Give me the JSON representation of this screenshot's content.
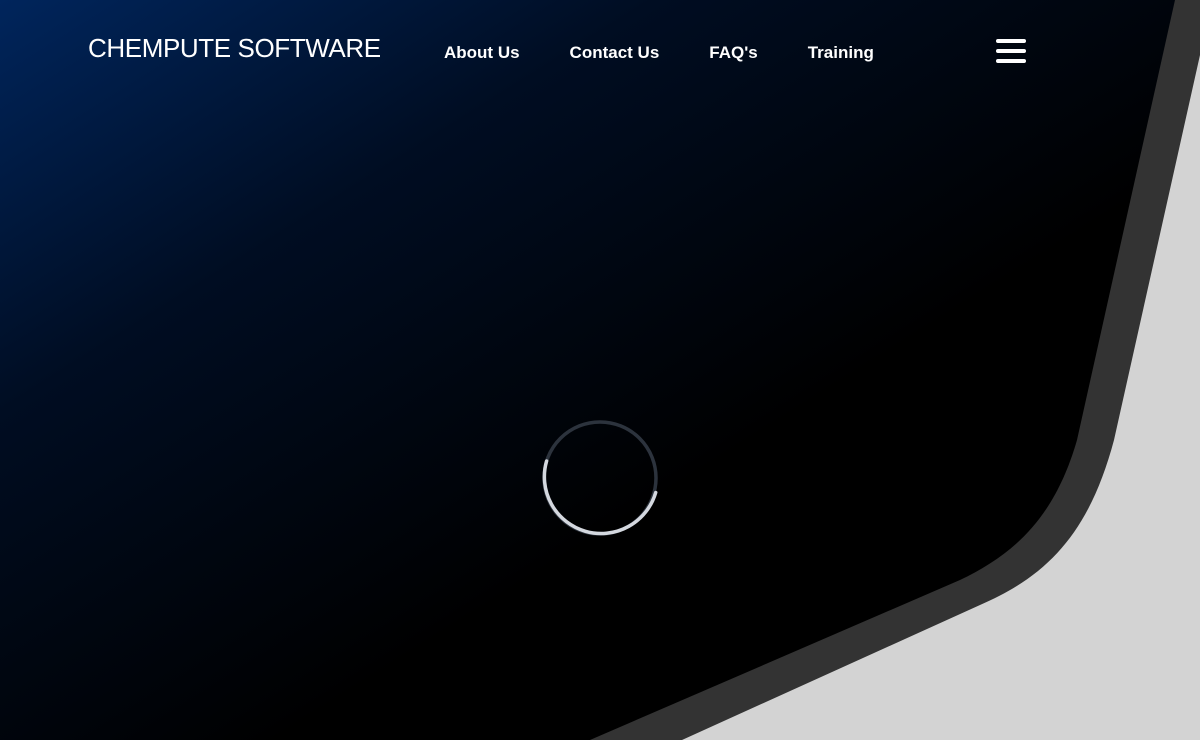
{
  "header": {
    "brand": "CHEMPUTE SOFTWARE",
    "nav": [
      {
        "label": "About Us"
      },
      {
        "label": "Contact Us"
      },
      {
        "label": "FAQ's"
      },
      {
        "label": "Training"
      }
    ],
    "menu_icon": "hamburger-menu-icon"
  },
  "loading": {
    "icon": "loading-spinner-icon"
  },
  "colors": {
    "hero_start": "#00255c",
    "hero_end": "#000000",
    "edge_band": "#333333",
    "page_background": "#d3d3d3",
    "text": "#ffffff",
    "spinner_track": "#2c333d",
    "spinner_arc": "#d4d8df"
  }
}
